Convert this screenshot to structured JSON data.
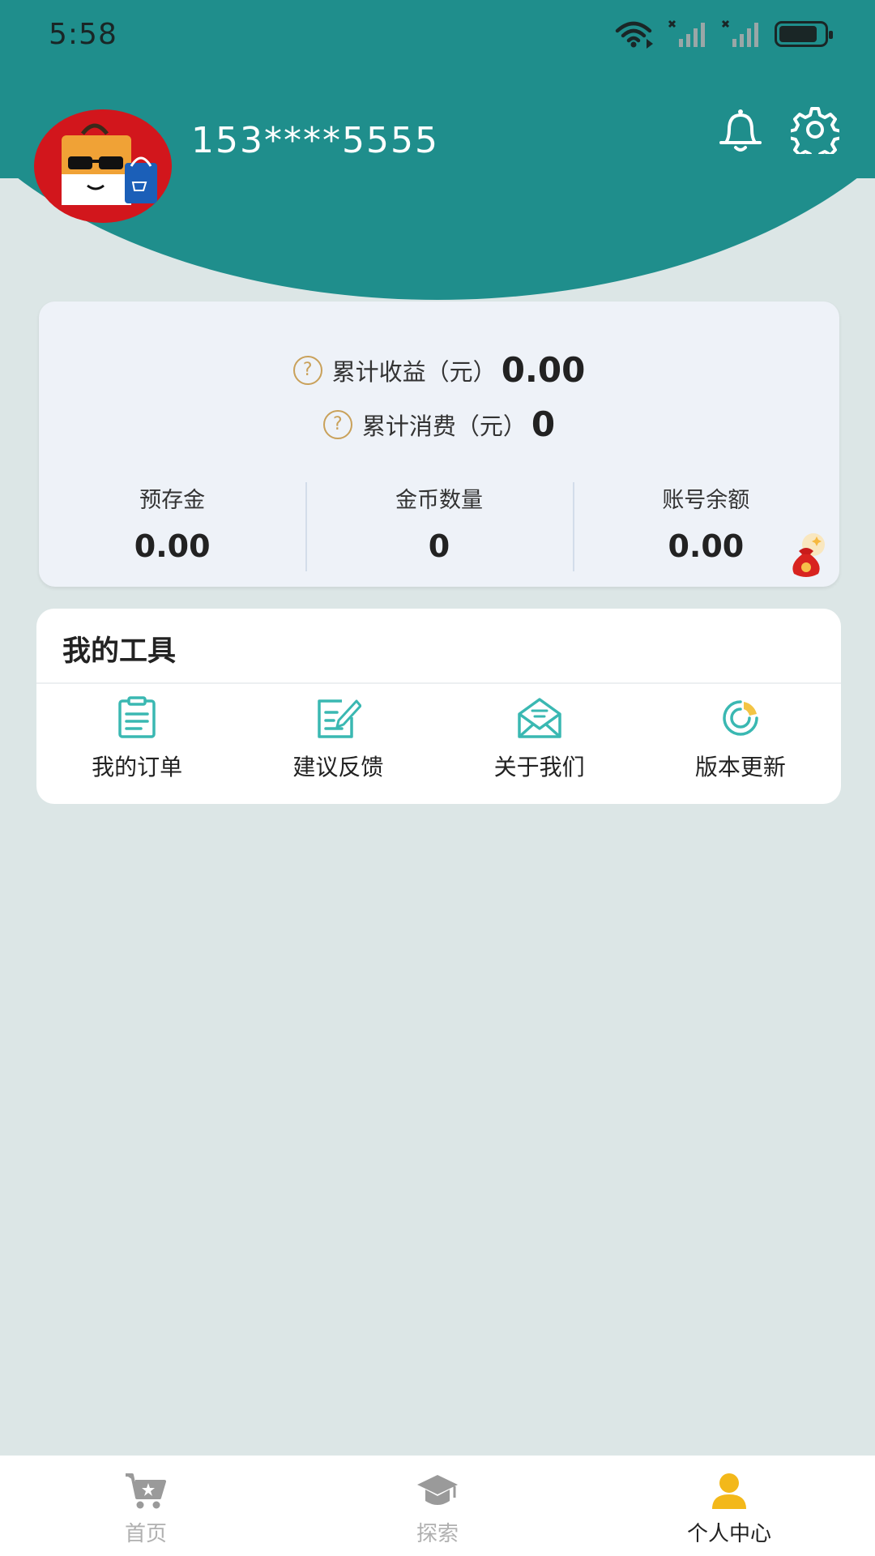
{
  "status_bar": {
    "time": "5:58"
  },
  "header": {
    "username": "153****5555",
    "avatar_icon": "shopping-bag-cat-avatar",
    "bell_icon": "bell-icon",
    "gear_icon": "gear-icon"
  },
  "stats": {
    "total_income_label": "累计收益（元）",
    "total_income_value": "0.00",
    "total_spend_label": "累计消费（元）",
    "total_spend_value": "0",
    "help_glyph": "?",
    "columns": [
      {
        "label": "预存金",
        "value": "0.00"
      },
      {
        "label": "金币数量",
        "value": "0"
      },
      {
        "label": "账号余额",
        "value": "0.00"
      }
    ]
  },
  "tools": {
    "title": "我的工具",
    "items": [
      {
        "label": "我的订单",
        "icon": "clipboard-icon"
      },
      {
        "label": "建议反馈",
        "icon": "edit-note-icon"
      },
      {
        "label": "关于我们",
        "icon": "envelope-icon"
      },
      {
        "label": "版本更新",
        "icon": "refresh-ring-icon"
      }
    ]
  },
  "bottom_nav": {
    "items": [
      {
        "label": "首页",
        "icon": "cart-icon",
        "active": false
      },
      {
        "label": "探索",
        "icon": "graduation-cap-icon",
        "active": false
      },
      {
        "label": "个人中心",
        "icon": "user-icon",
        "active": true
      }
    ]
  },
  "colors": {
    "header": "#1f8e8c",
    "accent_icon": "#3ab8b2",
    "active_nav": "#f3b81a",
    "inactive_nav": "#9a9a9a"
  }
}
